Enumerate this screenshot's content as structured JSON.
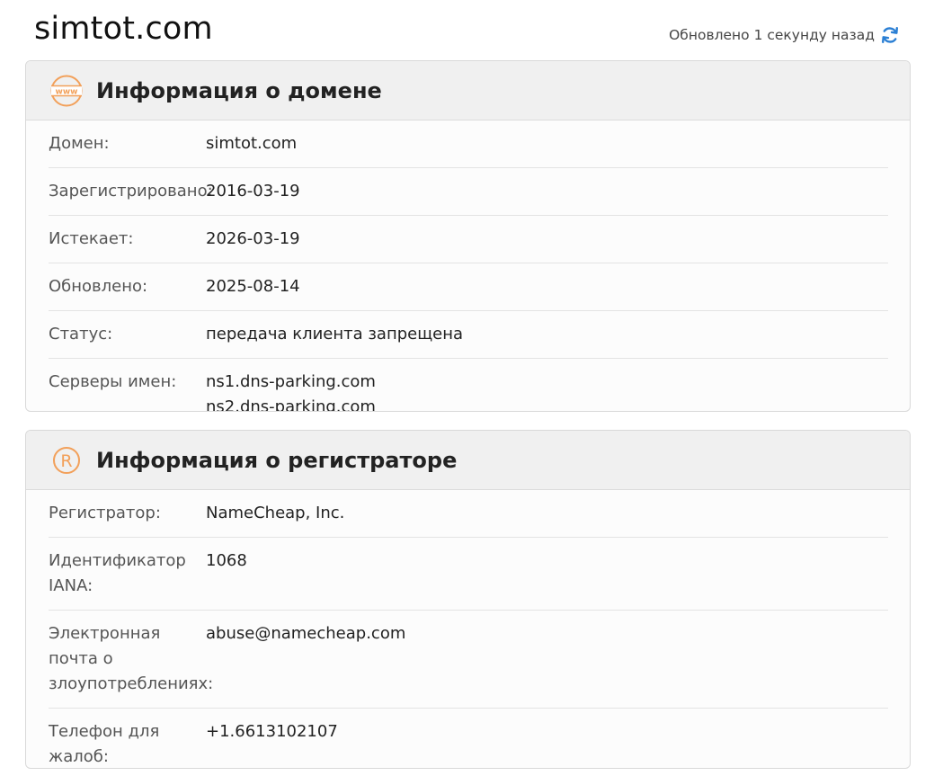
{
  "header": {
    "site_title": "simtot.com",
    "updated_text": "Обновлено 1 секунду назад",
    "accent_color": "#2b7fd4"
  },
  "domain_card": {
    "title": "Информация о домене",
    "icon": "www-icon",
    "icon_color": "#f2a05a",
    "rows": [
      {
        "label": "Домен:",
        "value": "simtot.com"
      },
      {
        "label": "Зарегистрировано:",
        "value": "2016-03-19"
      },
      {
        "label": "Истекает:",
        "value": "2026-03-19"
      },
      {
        "label": "Обновлено:",
        "value": "2025-08-14"
      },
      {
        "label": "Статус:",
        "value": "передача клиента запрещена"
      },
      {
        "label": "Серверы имен:",
        "values": [
          "ns1.dns-parking.com",
          "ns2.dns-parking.com"
        ]
      }
    ]
  },
  "registrar_card": {
    "title": "Информация о регистраторе",
    "icon": "registered-icon",
    "icon_color": "#f2a05a",
    "rows": [
      {
        "label": "Регистратор:",
        "value": "NameCheap, Inc."
      },
      {
        "label": "Идентификатор IANA:",
        "value": "1068"
      },
      {
        "label": "Электронная почта о злоупотреблениях:",
        "value": "abuse@namecheap.com"
      },
      {
        "label": "Телефон для жалоб:",
        "value": "+1.6613102107"
      }
    ]
  }
}
